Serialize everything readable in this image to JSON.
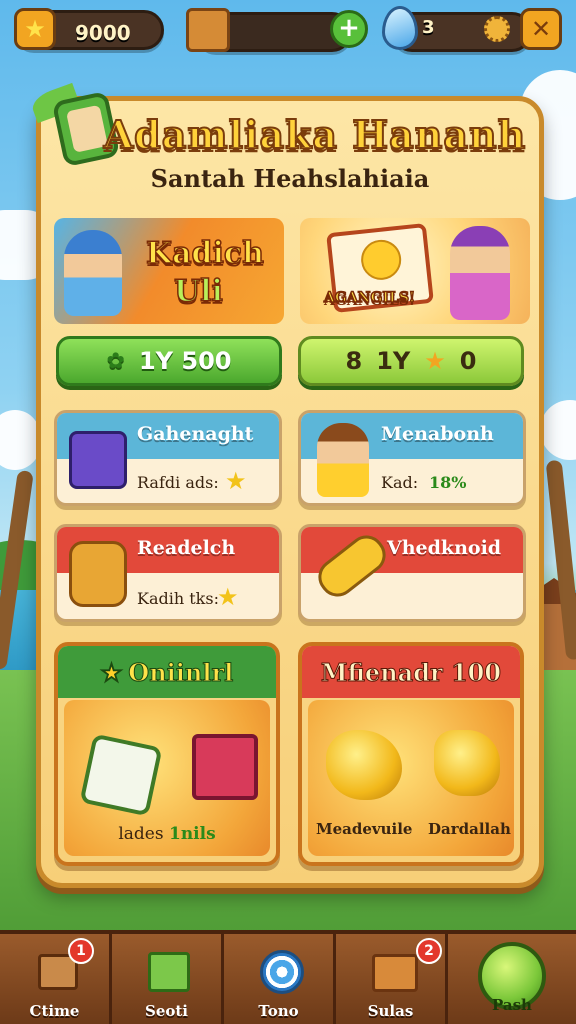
{
  "top_bar": {
    "coins": "9000",
    "energy_value": "",
    "gems": "3"
  },
  "panel": {
    "title": "Adamliaka Hananh",
    "subtitle": "Santah Heahslahiaia"
  },
  "banners": [
    {
      "line1": "Kadich",
      "line2": "Uli"
    },
    {
      "label": "AGANGILS!"
    }
  ],
  "buttons": [
    {
      "prefix": "",
      "text": "1Y 500"
    },
    {
      "prefix": "8",
      "text": "1Y",
      "suffix": "0"
    }
  ],
  "cards": [
    {
      "title": "Gahenaght",
      "sub": "Rafdi ads:"
    },
    {
      "title": "Menabonh",
      "sub": "Kad:",
      "value": "18%"
    },
    {
      "title": "Readelch",
      "sub": "Kadih tks:"
    },
    {
      "title": "Vhedknoid",
      "sub": ""
    }
  ],
  "big_panels": [
    {
      "title": "Oniinlrl",
      "caption": "lades",
      "caption_accent": "1nils"
    },
    {
      "title": "Mfienadr 100",
      "item1": "Meadevuile",
      "item2": "Dardallah"
    }
  ],
  "nav": [
    {
      "label": "Ctime",
      "badge": "1"
    },
    {
      "label": "Seoti",
      "badge": ""
    },
    {
      "label": "Tono",
      "badge": ""
    },
    {
      "label": "Sulas",
      "badge": "2"
    },
    {
      "label": "Pash",
      "badge": ""
    }
  ],
  "colors": {
    "accent_gold": "#ffd23a",
    "green_button": "#4ba82e",
    "card_header_blue": "#5cb6d8",
    "card_header_red": "#e2493a",
    "card_header_green": "#3f9b3a",
    "nav_wood": "#7b4420"
  }
}
